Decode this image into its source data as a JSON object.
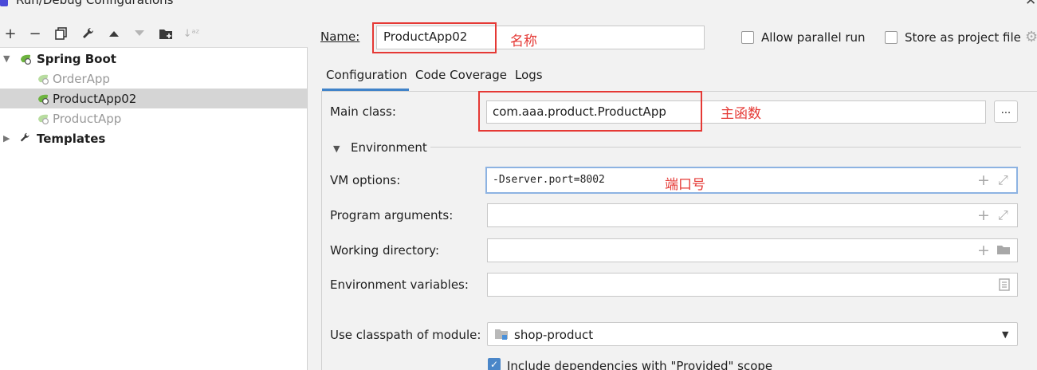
{
  "window": {
    "title": "Run/Debug Configurations"
  },
  "toolbar": {
    "items": [
      "add-icon",
      "remove-icon",
      "copy-icon",
      "wrench-icon",
      "move-up-icon",
      "move-down-icon",
      "folder-add-icon",
      "sort-icon"
    ]
  },
  "tree": {
    "spring_boot": "Spring Boot",
    "items": [
      "OrderApp",
      "ProductApp02",
      "ProductApp"
    ],
    "selected": "ProductApp02",
    "templates": "Templates"
  },
  "form": {
    "name_label": "Name:",
    "name_value": "ProductApp02",
    "note_name": "名称",
    "allow_parallel": "Allow parallel run",
    "store_project": "Store as project file",
    "tabs": [
      "Configuration",
      "Code Coverage",
      "Logs"
    ],
    "active_tab": "Configuration",
    "main_class_label": "Main class:",
    "main_class_value": "com.aaa.product.ProductApp",
    "browse_label": "...",
    "note_main": "主函数",
    "environment_label": "Environment",
    "vm_label": "VM options:",
    "vm_value": "-Dserver.port=8002",
    "note_port": "端口号",
    "program_args_label": "Program arguments:",
    "working_dir_label": "Working directory:",
    "env_vars_label": "Environment variables:",
    "classpath_label": "Use classpath of module:",
    "classpath_value": "shop-product",
    "include_deps_label": "Include dependencies with \"Provided\" scope",
    "include_deps_checked": true
  },
  "colors": {
    "accent": "#4083c9",
    "annotation": "#e53935",
    "selection": "#d5d5d5",
    "spring_green": "#6db33f"
  }
}
